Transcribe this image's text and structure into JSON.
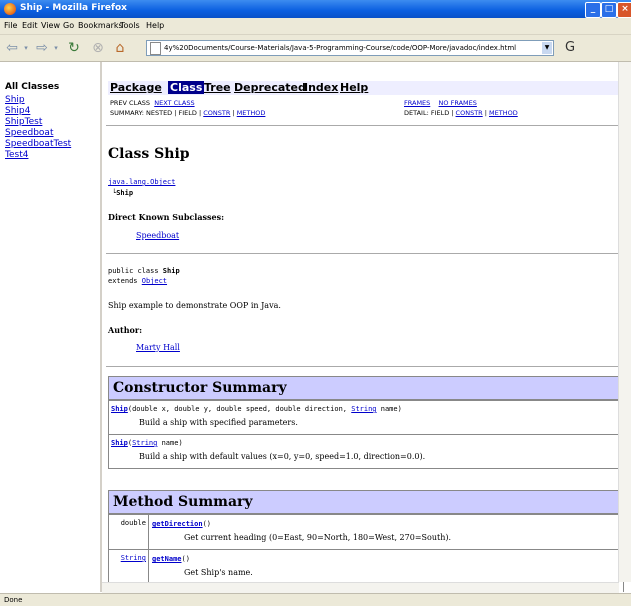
{
  "window": {
    "title": "Ship - Mozilla Firefox"
  },
  "menu": [
    "File",
    "Edit",
    "View",
    "Go",
    "Bookmarks",
    "Tools",
    "Help"
  ],
  "url": "4y%20Documents/Course-Materials/Java-5-Programming-Course/code/OOP-More/javadoc/index.html",
  "sidebar": {
    "heading": "All Classes",
    "items": [
      "Ship",
      "Ship4",
      "ShipTest",
      "Speedboat",
      "SpeedboatTest",
      "Test4"
    ]
  },
  "javadoc_nav": {
    "tabs": [
      "Package",
      "Class",
      "Tree",
      "Deprecated",
      "Index",
      "Help"
    ],
    "prev_class": "PREV CLASS",
    "next_class": "NEXT CLASS",
    "frames": "FRAMES",
    "no_frames": "NO FRAMES",
    "summary_prefix": "SUMMARY: NESTED | FIELD |",
    "constr": "CONSTR",
    "method": "METHOD",
    "detail_prefix": "DETAIL: FIELD |"
  },
  "class_info": {
    "title": "Class Ship",
    "hierarchy_parent": "java.lang.Object",
    "hierarchy_child": "Ship",
    "subclasses_label": "Direct Known Subclasses:",
    "subclasses": [
      "Speedboat"
    ],
    "decl_prefix": "public class",
    "decl_name": "Ship",
    "extends_label": "extends",
    "extends_name": "Object",
    "description": "Ship example to demonstrate OOP in Java.",
    "author_label": "Author:",
    "author": "Marty Hall"
  },
  "constructor_summary": {
    "title": "Constructor Summary",
    "rows": [
      {
        "name": "Ship",
        "params_pre": "(double x, double y, double speed, double direction, ",
        "param_link": "String",
        "params_post": " name)",
        "desc": "Build a ship with specified parameters."
      },
      {
        "name": "Ship",
        "params_pre": "(",
        "param_link": "String",
        "params_post": " name)",
        "desc": "Build a ship with default values (x=0, y=0, speed=1.0, direction=0.0)."
      }
    ]
  },
  "method_summary": {
    "title": "Method Summary",
    "rows": [
      {
        "type": "double",
        "name": "getDirection",
        "params": "()",
        "desc": "Get current heading (0=East, 90=North, 180=West, 270=South)."
      },
      {
        "type": "String",
        "name": "getName",
        "params": "()",
        "desc": "Get Ship's name."
      }
    ]
  },
  "status": "Done"
}
